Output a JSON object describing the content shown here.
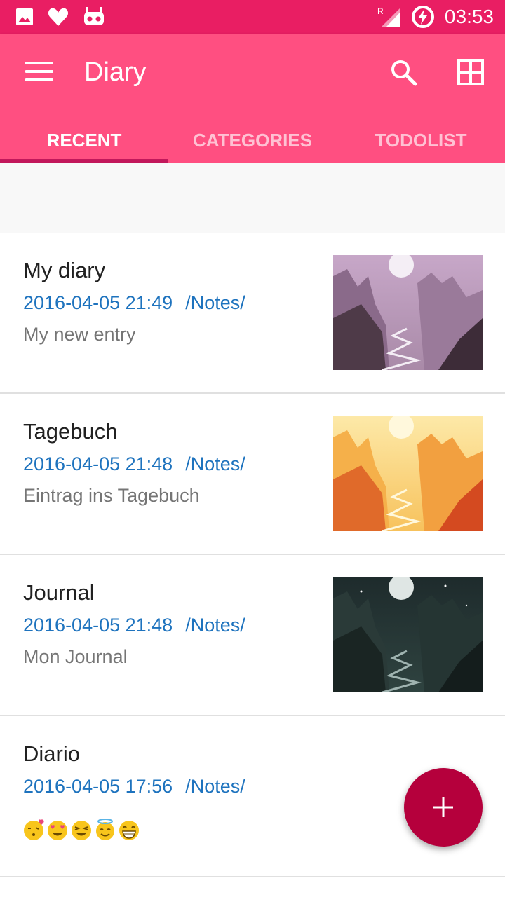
{
  "status_bar": {
    "time": "03:53",
    "icons": [
      "image-icon",
      "heart-icon",
      "robot-icon",
      "signal-roaming-icon",
      "battery-charging-icon"
    ],
    "roaming_indicator": "R"
  },
  "app_bar": {
    "title": "Diary",
    "menu_icon": "hamburger-menu-icon",
    "search_icon": "search-icon",
    "grid_icon": "grid-view-icon",
    "color": "#ff4f81"
  },
  "tabs": [
    {
      "label": "RECENT",
      "active": true
    },
    {
      "label": "CATEGORIES",
      "active": false
    },
    {
      "label": "TODOLIST",
      "active": false
    }
  ],
  "entries": [
    {
      "title": "My diary",
      "date": "2016-04-05 21:49",
      "path": "/Notes/",
      "description": "My new entry",
      "thumbnail": "purple-canyon-image"
    },
    {
      "title": "Tagebuch",
      "date": "2016-04-05 21:48",
      "path": "/Notes/",
      "description": "Eintrag ins Tagebuch",
      "thumbnail": "orange-canyon-image"
    },
    {
      "title": "Journal",
      "date": "2016-04-05 21:48",
      "path": "/Notes/",
      "description": "Mon Journal",
      "thumbnail": "dark-night-canyon-image"
    },
    {
      "title": "Diario",
      "date": "2016-04-05 17:56",
      "path": "/Notes/",
      "description": "",
      "emojis": [
        "kiss-emoji",
        "heart-eyes-emoji",
        "laughing-emoji",
        "angel-emoji",
        "grinning-emoji"
      ]
    }
  ],
  "fab": {
    "icon": "plus-icon",
    "color": "#b5003c"
  },
  "colors": {
    "status_bar": "#e91e63",
    "accent": "#c2185b",
    "link": "#1e73be"
  }
}
